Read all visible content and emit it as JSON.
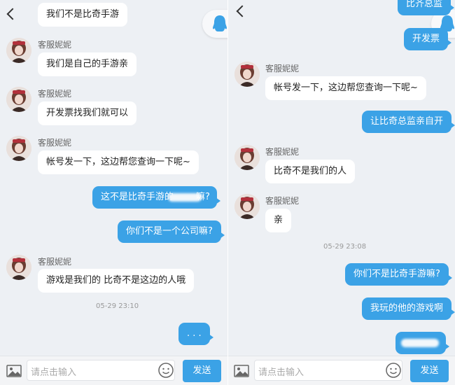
{
  "colors": {
    "accent": "#3ba2e6",
    "chat_bg": "#edf0f4",
    "bubble_in": "#ffffff"
  },
  "left": {
    "messages": {
      "m1": "我们不是比奇手游",
      "m2_name": "客服妮妮",
      "m2": "我们是自己的手游亲",
      "m3_name": "客服妮妮",
      "m3": "开发票找我们就可以",
      "m4_name": "客服妮妮",
      "m4": "帐号发一下，这边帮您查询一下呢~",
      "m5_prefix": "这不是比奇手游的",
      "m5_suffix": "嘛?",
      "m6": "你们不是一个公司嘛?",
      "m7_name": "客服妮妮",
      "m7": "游戏是我们的   比奇不是这边的人哦",
      "time": "05-29 23:10",
      "m8": ". . ."
    },
    "input": {
      "placeholder": "请点击输入",
      "send": "发送"
    }
  },
  "right": {
    "messages": {
      "r1": "比齐总监",
      "r2": "开发票",
      "r3_name": "客服妮妮",
      "r3": "帐号发一下，这边帮您查询一下呢~",
      "r4": "让比奇总监亲自开",
      "r5_name": "客服妮妮",
      "r5": "比奇不是我们的人",
      "r6_name": "客服妮妮",
      "r6": "亲",
      "time": "05-29 23:08",
      "r7": "你们不是比奇手游嘛?",
      "r8": "我玩的他的游戏啊"
    },
    "input": {
      "placeholder": "请点击输入",
      "send": "发送"
    }
  },
  "icons": [
    "back-arrow-icon",
    "qq-penguin-icon",
    "image-icon",
    "emoji-icon"
  ]
}
